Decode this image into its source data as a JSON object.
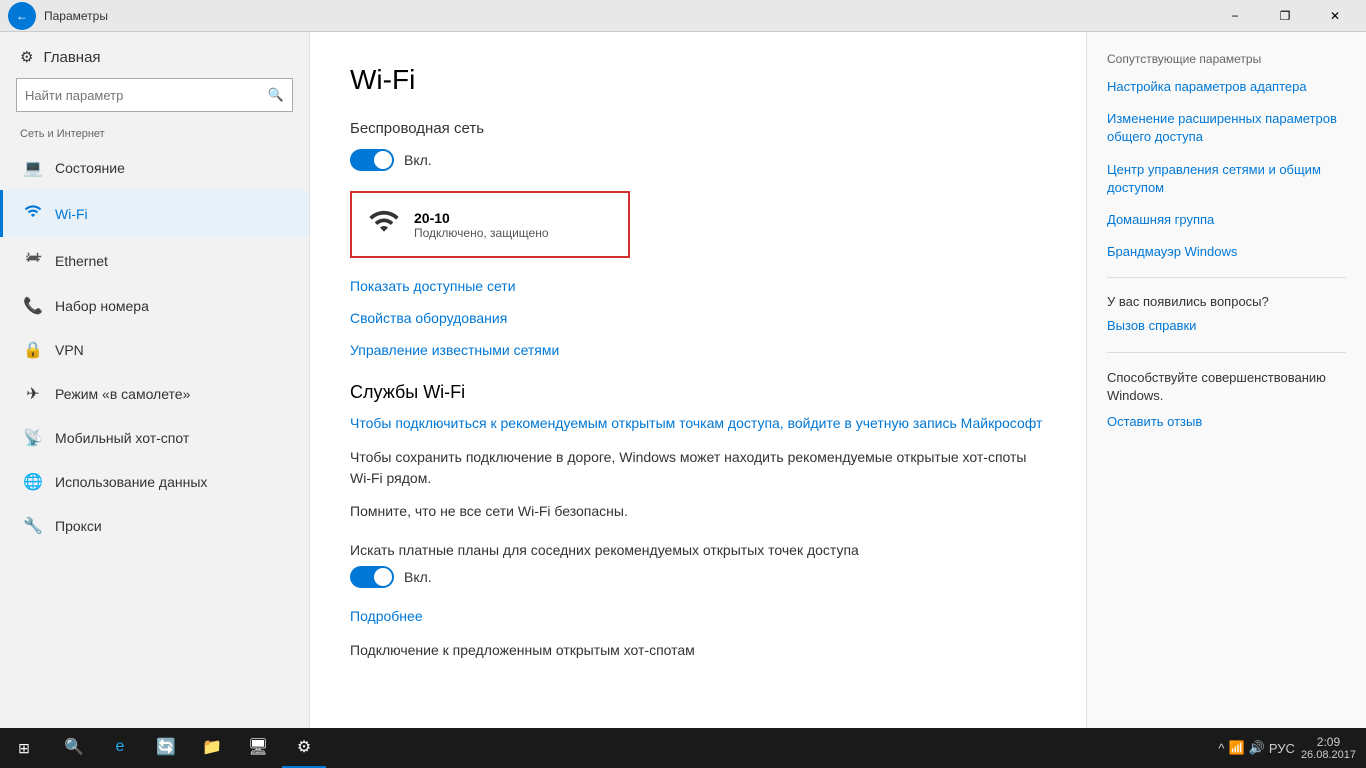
{
  "titlebar": {
    "title": "Параметры",
    "back_label": "←",
    "minimize": "−",
    "restore": "❐",
    "close": "✕"
  },
  "sidebar": {
    "home_label": "Главная",
    "search_placeholder": "Найти параметр",
    "section_label": "Сеть и Интернет",
    "items": [
      {
        "id": "status",
        "label": "Состояние",
        "icon": "💻"
      },
      {
        "id": "wifi",
        "label": "Wi-Fi",
        "icon": "📶",
        "active": true
      },
      {
        "id": "ethernet",
        "label": "Ethernet",
        "icon": "🖧"
      },
      {
        "id": "dialup",
        "label": "Набор номера",
        "icon": "📞"
      },
      {
        "id": "vpn",
        "label": "VPN",
        "icon": "🔒"
      },
      {
        "id": "airplane",
        "label": "Режим «в самолете»",
        "icon": "✈"
      },
      {
        "id": "hotspot",
        "label": "Мобильный хот-спот",
        "icon": "📡"
      },
      {
        "id": "data_usage",
        "label": "Использование данных",
        "icon": "🌐"
      },
      {
        "id": "proxy",
        "label": "Прокси",
        "icon": "🔧"
      }
    ]
  },
  "content": {
    "page_title": "Wi-Fi",
    "wireless_section": "Беспроводная сеть",
    "toggle_state": "Вкл.",
    "network_name": "20-10",
    "network_status": "Подключено, защищено",
    "link_show_networks": "Показать доступные сети",
    "link_hardware_props": "Свойства оборудования",
    "link_manage_networks": "Управление известными сетями",
    "services_title": "Службы Wi-Fi",
    "services_link": "Чтобы подключиться к рекомендуемым открытым точкам доступа, войдите в учетную запись Майкрософт",
    "services_text1": "Чтобы сохранить подключение в дороге, Windows может находить рекомендуемые открытые хот-споты Wi-Fi рядом.",
    "services_text2": "Помните, что не все сети Wi-Fi безопасны.",
    "paid_section_label": "Искать платные планы для соседних рекомендуемых открытых точек доступа",
    "toggle2_state": "Вкл.",
    "link_more": "Подробнее",
    "bottom_text": "Подключение к предложенным открытым хот-спотам"
  },
  "right_panel": {
    "section_label": "Сопутствующие параметры",
    "links": [
      {
        "label": "Настройка параметров адаптера"
      },
      {
        "label": "Изменение расширенных параметров общего доступа"
      },
      {
        "label": "Центр управления сетями и общим доступом"
      },
      {
        "label": "Домашняя группа"
      },
      {
        "label": "Брандмауэр Windows"
      }
    ],
    "question_label": "У вас появились вопросы?",
    "help_link": "Вызов справки",
    "contribute_label": "Способствуйте совершенствованию Windows.",
    "feedback_link": "Оставить отзыв"
  },
  "taskbar": {
    "time": "2:09",
    "date": "26.08.2017",
    "lang": "РУС",
    "apps": [
      "⊞",
      "e",
      "🔄",
      "📁",
      "🖥",
      "⚙"
    ]
  }
}
